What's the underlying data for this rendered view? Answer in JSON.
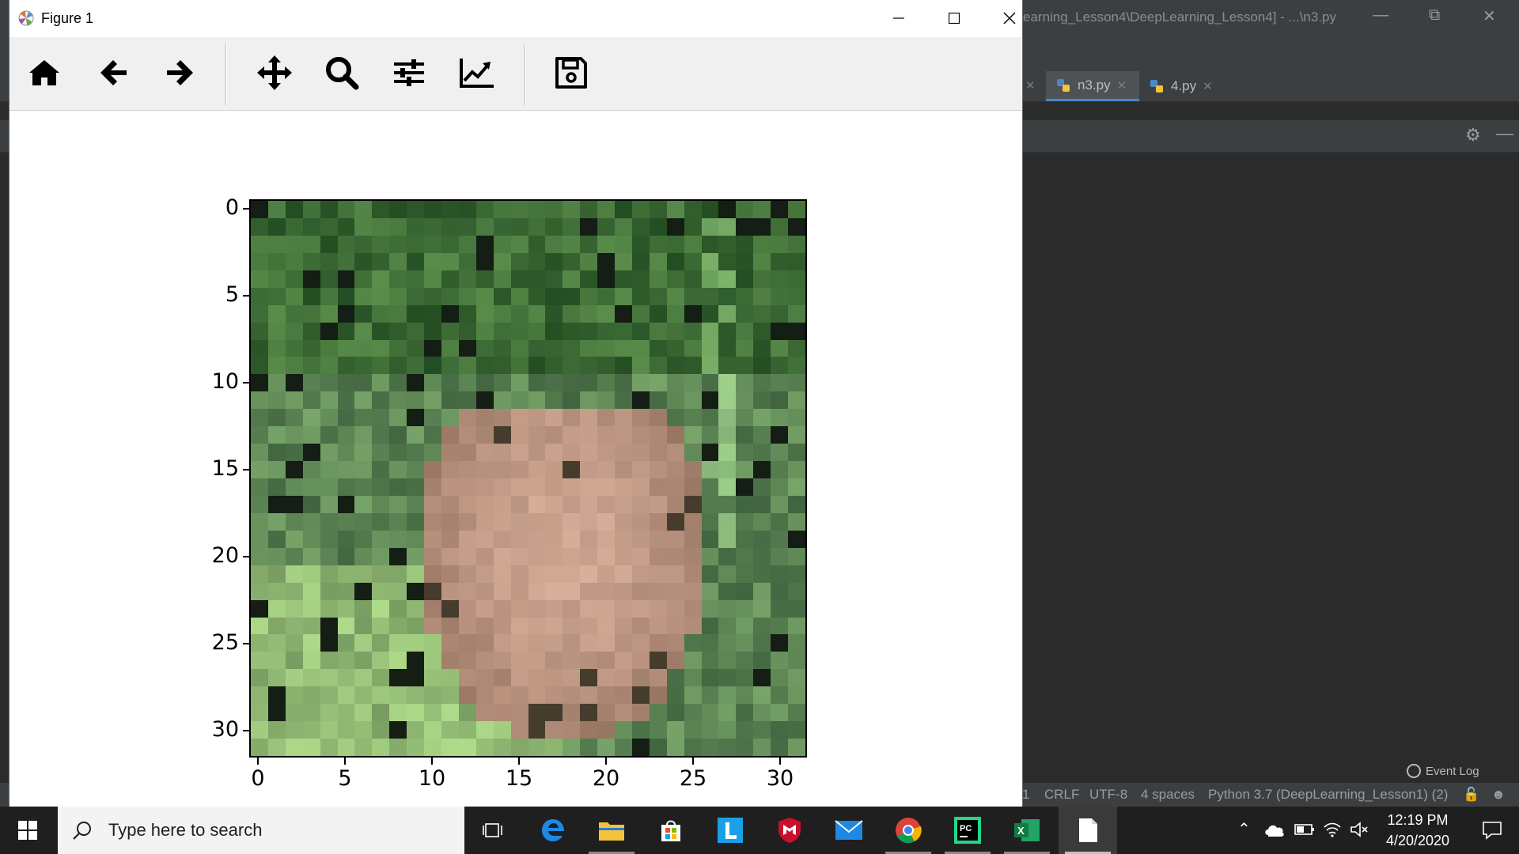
{
  "ide": {
    "title": "earning_Lesson4\\DeepLearning_Lesson4] - ...\\n3.py",
    "run_config": "n3",
    "tabs": [
      {
        "label": "n3.py",
        "active": true
      },
      {
        "label": "4.py",
        "active": false
      }
    ],
    "status": {
      "line_sep": "CRLF",
      "encoding": "UTF-8",
      "indent": "4 spaces",
      "interpreter": "Python 3.7 (DeepLearning_Lesson1) (2)",
      "edge_digit": "1",
      "event_log": "Event Log"
    }
  },
  "figure": {
    "title": "Figure 1",
    "toolbar": [
      "home-icon",
      "back-icon",
      "forward-icon",
      "pan-icon",
      "zoom-icon",
      "configure-subplots-icon",
      "edit-axis-icon",
      "save-icon"
    ]
  },
  "chart_data": {
    "type": "heatmap",
    "title": "",
    "xlabel": "",
    "ylabel": "",
    "x_ticks": [
      "0",
      "5",
      "10",
      "15",
      "20",
      "25",
      "30"
    ],
    "y_ticks": [
      "0",
      "5",
      "10",
      "15",
      "20",
      "25",
      "30"
    ],
    "xlim": [
      -0.5,
      31.5
    ],
    "ylim": [
      31.5,
      -0.5
    ],
    "image_size": [
      32,
      32
    ],
    "content": "32x32 RGB image, green foliage background with a light brown/pink animal face in the centre"
  },
  "taskbar": {
    "search_placeholder": "Type here to search",
    "apps": [
      "task-view",
      "edge",
      "file-explorer",
      "store",
      "l-app",
      "mcafee",
      "mail",
      "chrome",
      "pycharm",
      "excel",
      "notepad"
    ],
    "time": "12:19 PM",
    "date": "4/20/2020"
  }
}
